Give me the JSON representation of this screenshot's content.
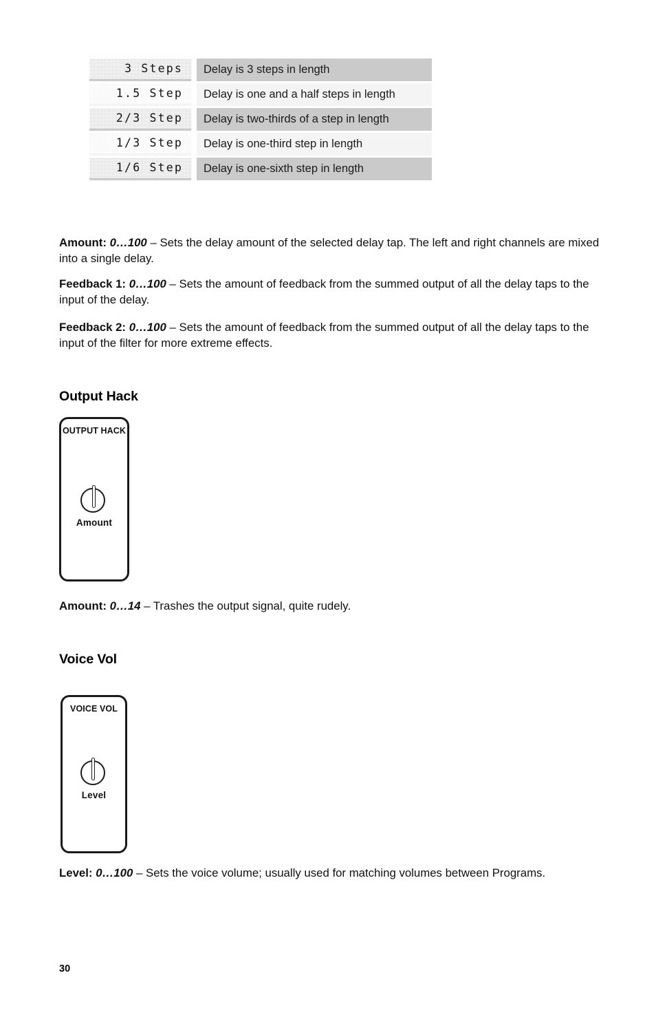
{
  "document": {
    "page_number": "30"
  },
  "steps_table": {
    "rows": [
      {
        "value": "3 Steps",
        "description": "Delay is 3 steps in length"
      },
      {
        "value": "1.5 Step",
        "description": "Delay is one and a half steps in length"
      },
      {
        "value": "2/3 Step",
        "description": "Delay is two-thirds of a step in length"
      },
      {
        "value": "1/3 Step",
        "description": "Delay is one-third step in length"
      },
      {
        "value": "1/6 Step",
        "description": "Delay is one-sixth step in length"
      }
    ]
  },
  "delay_params": [
    {
      "label": "Amount:",
      "range": "0…100",
      "dash": "–",
      "text": "Sets the delay amount of the selected delay tap. The left and right channels are mixed into a single delay."
    },
    {
      "label": "Feedback 1:",
      "range": "0…100",
      "dash": "–",
      "text": "Sets the amount of feedback from the summed output of all the delay taps to the input of the delay."
    },
    {
      "label": "Feedback 2:",
      "range": "0…100",
      "dash": "–",
      "text": "Sets the amount of feedback from the summed output of all the delay taps to the input of the filter for more extreme effects."
    }
  ],
  "output_hack": {
    "heading": "Output Hack",
    "panel_title": "OUTPUT HACK",
    "knob_label": "Amount",
    "param": {
      "label": "Amount:",
      "range": "0…14",
      "dash": "–",
      "text": "Trashes the output signal, quite rudely."
    }
  },
  "voice_vol": {
    "heading": "Voice Vol",
    "panel_title": "VOICE VOL",
    "knob_label": "Level",
    "param": {
      "label": "Level:",
      "range": "0…100",
      "dash": "–",
      "text": "Sets the voice volume; usually used for matching volumes between Programs."
    }
  },
  "colors": {
    "row_dark": "#cacaca",
    "row_light": "#f4f4f4",
    "ink": "#111111",
    "page_background": "#ffffff"
  }
}
